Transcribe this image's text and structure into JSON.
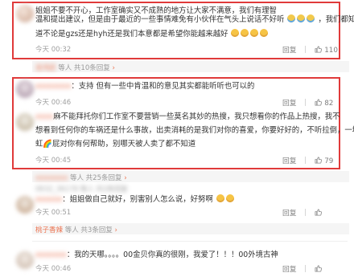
{
  "comments": [
    {
      "lines": [
        "姐姐不要不开心，工作室确实又不成熟的地方让大家不满意，我们有理智",
        "温和提出建议，但是由于最近的一些事情难免有小伙伴在气头上说话不好听",
        "，我们都知",
        "道不论是gzs还是hyh还是我们本意都是希望你能越来越好"
      ],
      "time": "今天 00:32",
      "reply_label": "回复",
      "likes": "110",
      "reply_bar": {
        "nick": "吉鸿还",
        "text": "等人 共10条回复"
      }
    },
    {
      "username_label": "",
      "text_prefix": "：支持 但有一些中肯温和的意见其实都能听听也可以的",
      "time": "今天 00:46",
      "reply_label": "回复",
      "likes": "82"
    },
    {
      "lines": [
        "麻不能拜托你们工作室不要营销一些莫名其妙的热搜，我只想看你的作品上热搜，我不",
        "想看到任何你的车祸还是什么事故，出卖消耗的是我们对你的喜爱，你要好好的，不听拉倒，一堆彩",
        "虹🌈屁对你有何帮助，别哪天被人卖了都不知道"
      ],
      "time": "今天 00:45",
      "reply_label": "回复",
      "likes": "79",
      "reply_bar": {
        "nick": "",
        "text": "等人 共25条回复"
      }
    },
    {
      "meta_top": "0632_36178 等人 共2条回复",
      "text": "：姐姐做自己就好，别害别人怎么说，好努啊",
      "time": "今天 00:51",
      "reply_label": "回复",
      "reply_bar": {
        "nick": "桃子香辣",
        "text": "等人 共3条回复"
      }
    },
    {
      "text": "：我的天哪。。。。00金贝你真的很刚，我爱了！！！00外境古神",
      "time": "今天 00:46",
      "reply_label": "回复"
    }
  ]
}
